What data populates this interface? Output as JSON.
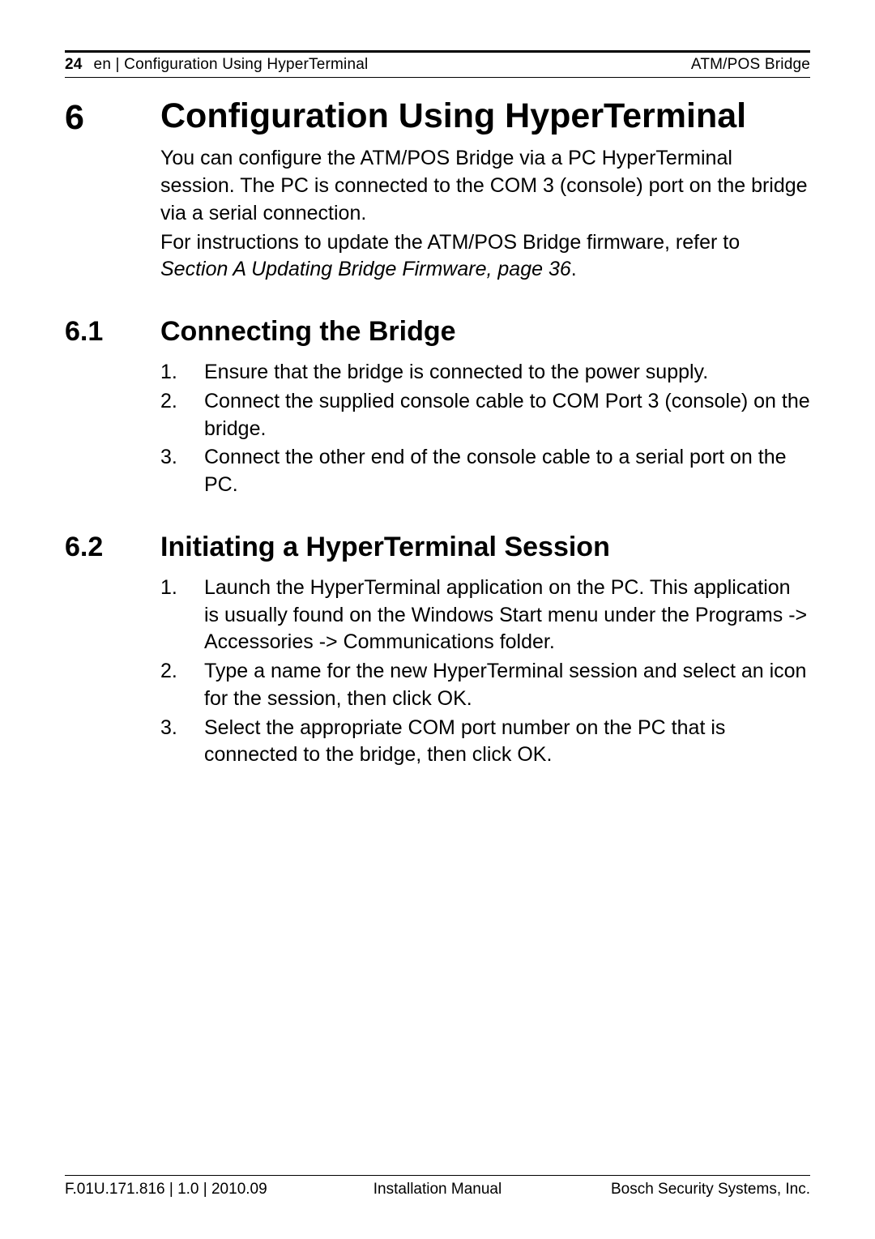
{
  "header": {
    "page_number": "24",
    "section_label": "en | Configuration Using HyperTerminal",
    "product": "ATM/POS Bridge"
  },
  "chapter": {
    "number": "6",
    "title": "Configuration Using HyperTerminal",
    "intro_1": "You can configure the ATM/POS Bridge via a PC HyperTerminal session. The PC is connected to the COM 3 (console) port on the bridge via a serial connection.",
    "intro_2_pre": "For instructions to update the ATM/POS Bridge firmware, refer to ",
    "intro_2_italic": "Section A Updating Bridge Firmware, page 36",
    "intro_2_post": "."
  },
  "sections": [
    {
      "number": "6.1",
      "title": "Connecting the Bridge",
      "items": [
        {
          "n": "1.",
          "text": "Ensure that the bridge is connected to the power supply."
        },
        {
          "n": "2.",
          "text": "Connect the supplied console cable to COM Port 3 (console) on the bridge."
        },
        {
          "n": "3.",
          "text": "Connect the other end of the console cable to a serial port on the PC."
        }
      ]
    },
    {
      "number": "6.2",
      "title": "Initiating a HyperTerminal Session",
      "items": [
        {
          "n": "1.",
          "text": "Launch the HyperTerminal application on the PC. This application is usually found on the Windows Start menu under the Programs -> Accessories -> Communications folder."
        },
        {
          "n": "2.",
          "text": "Type a name for the new HyperTerminal session and select an icon for the session, then click OK."
        },
        {
          "n": "3.",
          "text": "Select the appropriate COM port number on the PC that is connected to the bridge, then click OK."
        }
      ]
    }
  ],
  "footer": {
    "left": "F.01U.171.816 | 1.0 | 2010.09",
    "center": "Installation Manual",
    "right": "Bosch Security Systems, Inc."
  }
}
